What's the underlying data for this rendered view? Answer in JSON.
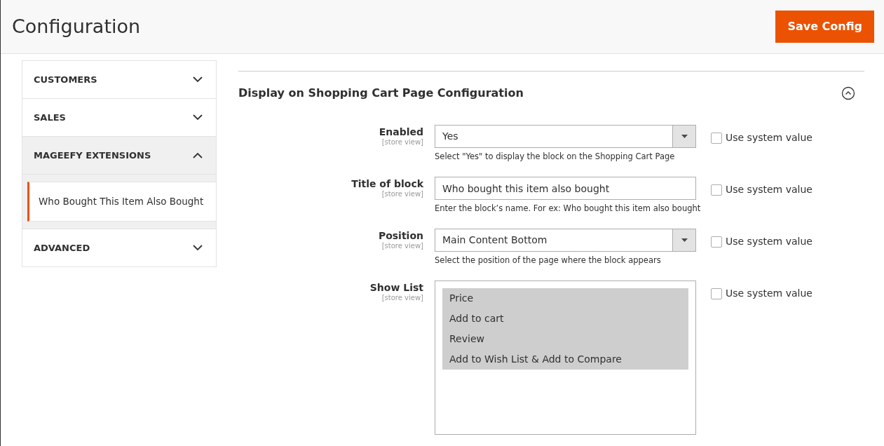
{
  "header": {
    "title": "Configuration",
    "save_button": "Save Config"
  },
  "sidebar": {
    "items": [
      {
        "label": "CUSTOMERS",
        "expanded": false
      },
      {
        "label": "SALES",
        "expanded": false
      },
      {
        "label": "MAGEEFY EXTENSIONS",
        "expanded": true,
        "children": [
          {
            "label": "Who Bought This Item Also Bought",
            "selected": true
          }
        ]
      },
      {
        "label": "ADVANCED",
        "expanded": false
      }
    ]
  },
  "section": {
    "title": "Display on Shopping Cart Page Configuration",
    "expanded": true
  },
  "fields": [
    {
      "kind": "select",
      "label": "Enabled",
      "scope": "[store view]",
      "value": "Yes",
      "note": "Select \"Yes\" to display the block on the Shopping Cart Page",
      "use_system": {
        "label": "Use system value",
        "checked": false
      }
    },
    {
      "kind": "text",
      "label": "Title of block",
      "scope": "[store view]",
      "value": "Who bought this item also bought",
      "note": "Enter the block’s name. For ex: Who bought this item also bought",
      "use_system": {
        "label": "Use system value",
        "checked": false
      }
    },
    {
      "kind": "select",
      "label": "Position",
      "scope": "[store view]",
      "value": "Main Content Bottom",
      "note": "Select the position of the page where the block appears",
      "use_system": {
        "label": "Use system value",
        "checked": false
      }
    },
    {
      "kind": "multiselect",
      "label": "Show List",
      "scope": "[store view]",
      "options": [
        {
          "label": "Price",
          "selected": true
        },
        {
          "label": "Add to cart",
          "selected": true
        },
        {
          "label": "Review",
          "selected": true
        },
        {
          "label": "Add to Wish List & Add to Compare",
          "selected": true
        }
      ],
      "use_system": {
        "label": "Use system value",
        "checked": false
      }
    }
  ]
}
